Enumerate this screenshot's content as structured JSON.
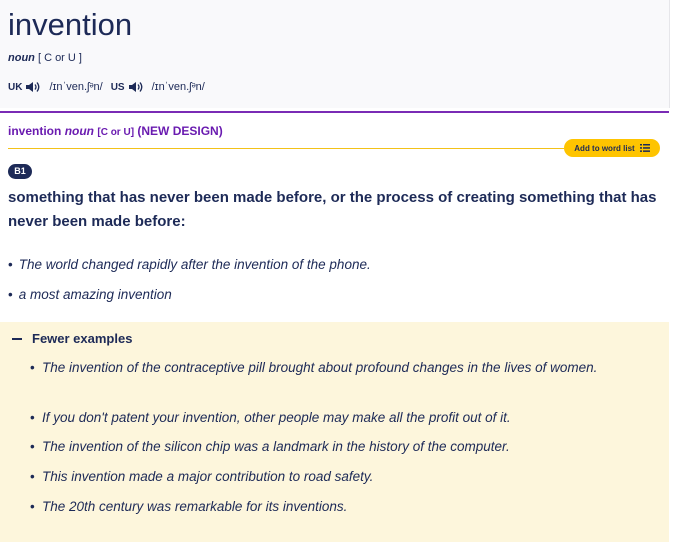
{
  "entry": {
    "headword": "invention",
    "pos": "noun",
    "grammar": "[ C or U ]",
    "uk_label": "UK",
    "uk_ipa": "/ɪnˈven.ʃᵊn/",
    "us_label": "US",
    "us_ipa": "/ɪnˈven.ʃᵊn/"
  },
  "sense": {
    "headword": "invention",
    "pos": "noun",
    "grammar": "[C or U]",
    "tag": "(NEW DESIGN)",
    "add_button_label": "Add to word list",
    "level": "B1",
    "definition": "something that has never been made before, or the process of creating something that has never been made before:",
    "examples": [
      "The world changed rapidly after the invention of the phone.",
      "a most amazing invention"
    ]
  },
  "more_examples": {
    "toggle_label": "Fewer examples",
    "items": [
      "The invention of the contraceptive pill brought about profound changes in the lives of women.",
      "If you don't patent your invention, other people may make all the profit out of it.",
      "The invention of the silicon chip was a landmark in the history of the computer.",
      "This invention made a major contribution to road safety.",
      "The 20th century was remarkable for its inventions."
    ]
  },
  "colors": {
    "text": "#1d2a57",
    "accent_purple": "#7a2bb5",
    "button_yellow": "#fec400",
    "examples_bg": "#fdf6dc"
  }
}
